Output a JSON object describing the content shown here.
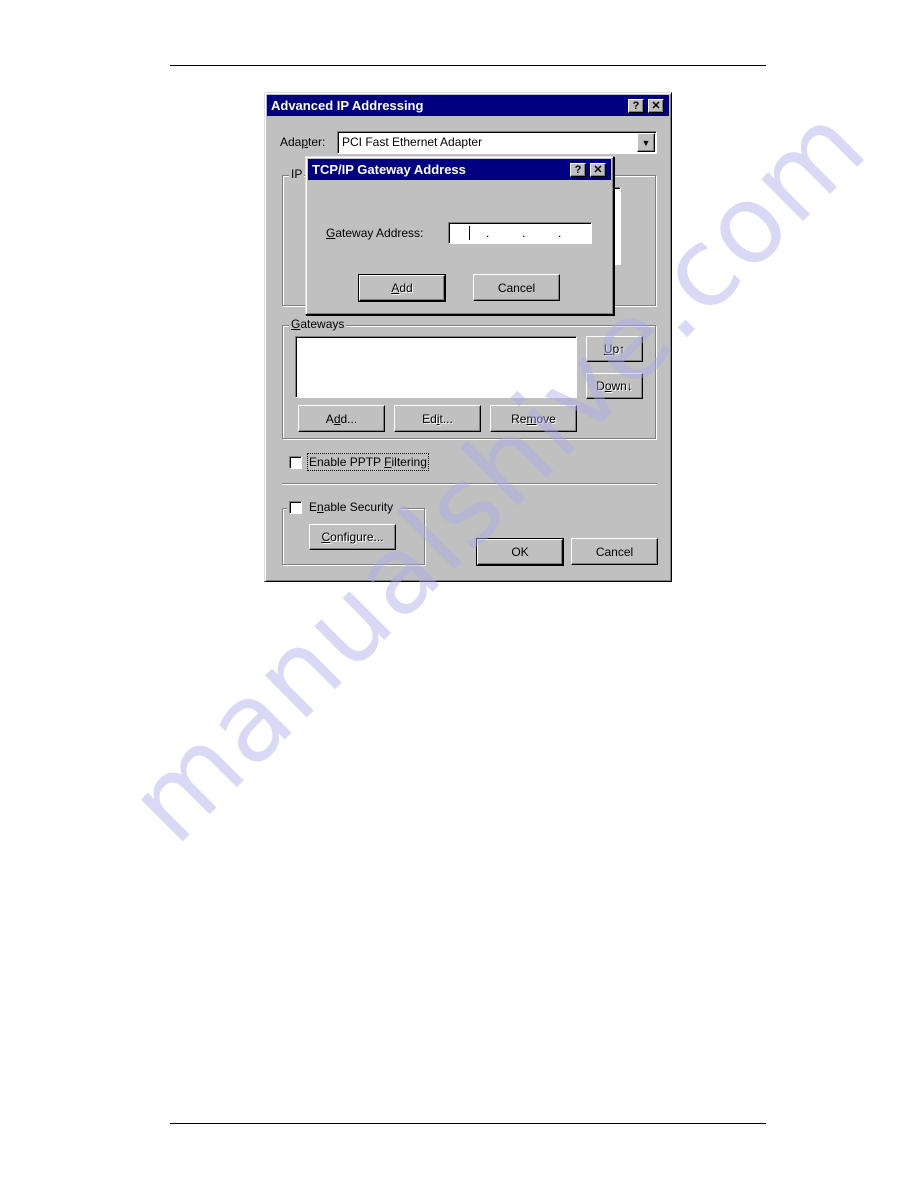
{
  "page": {
    "watermark": "manualshive.com"
  },
  "main_dialog": {
    "title": "Advanced IP Addressing",
    "help_glyph": "?",
    "close_glyph": "✕",
    "adapter_label_pre": "Ada",
    "adapter_label_ul": "p",
    "adapter_label_post": "ter:",
    "adapter_value": "PCI Fast Ethernet Adapter",
    "dropdown_glyph": "▼",
    "ip_group_label": "IP",
    "gateways_group": {
      "label_ul": "G",
      "label_rest": "ateways",
      "items": [],
      "up_ul": "U",
      "up_rest": "p↑",
      "down_pre": "D",
      "down_ul": "o",
      "down_rest": "wn↓",
      "add_pre": "A",
      "add_ul": "d",
      "add_rest": "d...",
      "edit_pre": "Ed",
      "edit_ul": "i",
      "edit_rest": "t...",
      "remove_pre": "Re",
      "remove_ul": "m",
      "remove_rest": "ove"
    },
    "pptp": {
      "label_pre": "Enable PPTP ",
      "label_ul": "F",
      "label_rest": "iltering",
      "checked": false
    },
    "security": {
      "label_pre": "E",
      "label_ul": "n",
      "label_rest": "able Security",
      "checked": false,
      "configure_ul": "C",
      "configure_rest": "onfigure..."
    },
    "ok_label": "OK",
    "cancel_label": "Cancel"
  },
  "gateway_dialog": {
    "title": "TCP/IP Gateway Address",
    "help_glyph": "?",
    "close_glyph": "✕",
    "field_label_ul": "G",
    "field_label_rest": "ateway Address:",
    "address_octets": [
      "",
      "",
      "",
      ""
    ],
    "octet_separator": ".",
    "add_ul": "A",
    "add_rest": "dd",
    "cancel_label": "Cancel"
  }
}
